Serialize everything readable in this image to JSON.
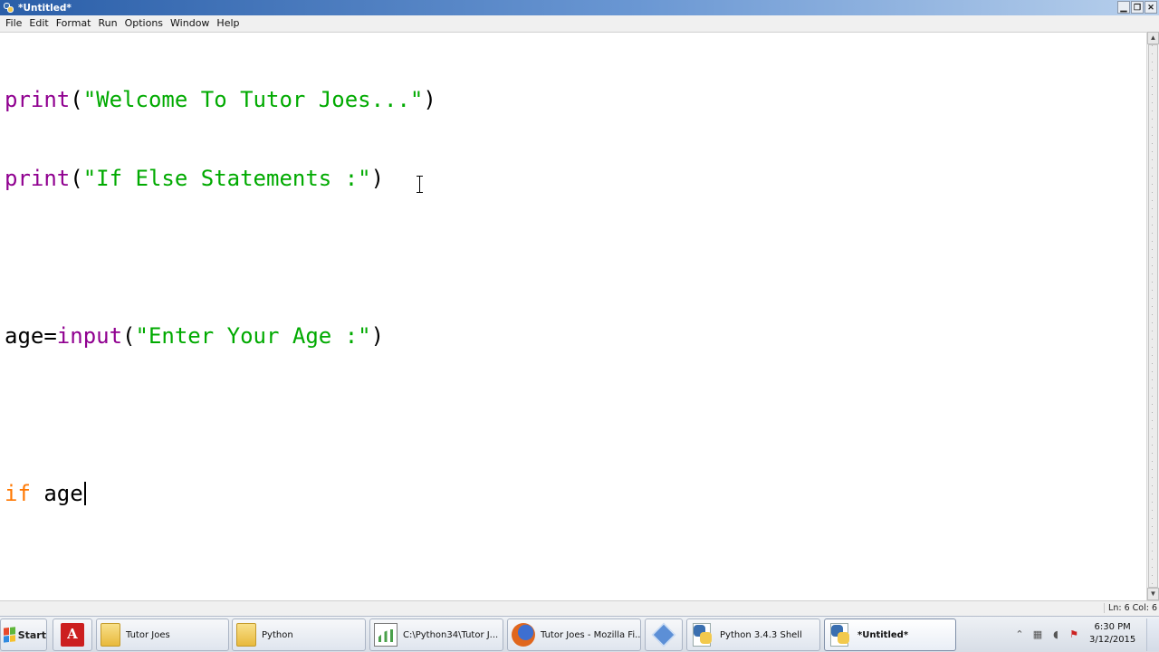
{
  "window": {
    "title": "*Untitled*",
    "controls": {
      "minimize": "▁",
      "maximize": "❐",
      "close": "✕"
    }
  },
  "menu": {
    "items": [
      "File",
      "Edit",
      "Format",
      "Run",
      "Options",
      "Window",
      "Help"
    ]
  },
  "editor": {
    "lines": [
      {
        "builtin": "print",
        "open": "(",
        "string": "\"Welcome To Tutor Joes...\"",
        "close": ")"
      },
      {
        "builtin": "print",
        "open": "(",
        "string": "\"If Else Statements :\"",
        "close": ")"
      },
      {
        "empty": true
      },
      {
        "plain": "age=",
        "builtin": "input",
        "open": "(",
        "string": "\"Enter Your Age :\"",
        "close": ")"
      },
      {
        "empty": true
      },
      {
        "keyword": "if",
        "plain": " age"
      }
    ],
    "colors": {
      "builtin": "#900090",
      "keyword": "#ff7700",
      "string": "#00aa00"
    }
  },
  "status": {
    "position": "Ln: 6 Col: 6"
  },
  "taskbar": {
    "start_label": "Start",
    "pinned": [
      {
        "icon": "acrobat-icon"
      }
    ],
    "buttons": [
      {
        "icon": "folder-icon",
        "label": "Tutor Joes"
      },
      {
        "icon": "folder-icon",
        "label": "Python"
      },
      {
        "icon": "notepadpp-icon",
        "label": "C:\\Python34\\Tutor J..."
      },
      {
        "icon": "firefox-icon",
        "label": "Tutor Joes - Mozilla Fi..."
      },
      {
        "icon": "app-icon",
        "label": ""
      },
      {
        "icon": "python-icon",
        "label": "Python 3.4.3 Shell"
      },
      {
        "icon": "python-icon",
        "label": "*Untitled*",
        "active": true
      }
    ],
    "tray": {
      "icons": [
        "chevron-up-icon",
        "network-icon",
        "volume-icon",
        "action-center-icon"
      ],
      "time": "6:30 PM",
      "date": "3/12/2015"
    }
  }
}
